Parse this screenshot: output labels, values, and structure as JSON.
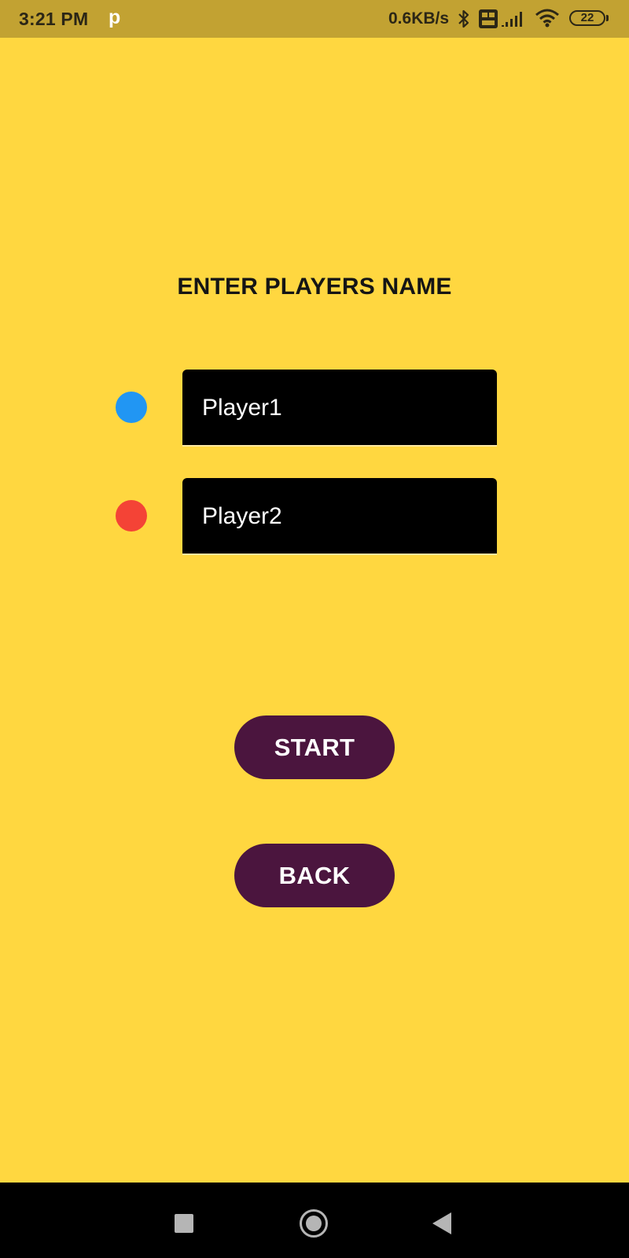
{
  "status_bar": {
    "time": "3:21 PM",
    "notification_letter": "p",
    "network_speed": "0.6KB/s",
    "battery_level": "22",
    "icons": [
      "bluetooth-icon",
      "volte-icon",
      "signal-icon",
      "wifi-icon",
      "battery-icon"
    ]
  },
  "screen": {
    "title": "ENTER PLAYERS NAME",
    "players": [
      {
        "name": "Player1",
        "color": "#2196F3"
      },
      {
        "name": "Player2",
        "color": "#F44336"
      }
    ],
    "start_label": "START",
    "back_label": "BACK"
  },
  "colors": {
    "background": "#FFD740",
    "button": "#4B153E",
    "field": "#000000"
  },
  "nav_bar": {
    "icons": [
      "recents-icon",
      "home-icon",
      "back-icon"
    ]
  }
}
